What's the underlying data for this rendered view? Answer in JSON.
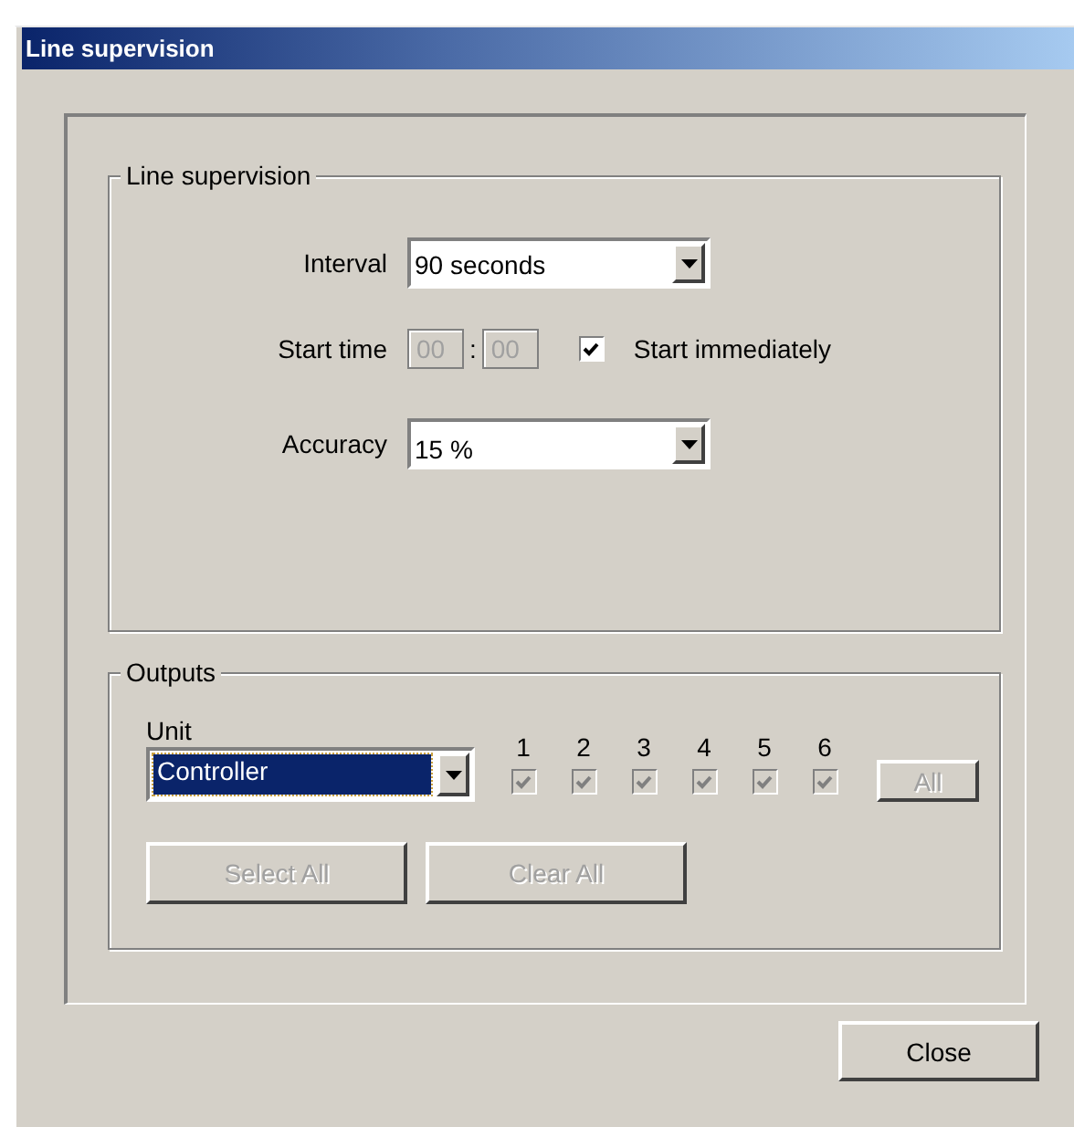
{
  "window": {
    "title": "Line supervision"
  },
  "line_supervision": {
    "title": "Line supervision",
    "interval": {
      "label": "Interval",
      "value": "90 seconds"
    },
    "start_time": {
      "label": "Start time",
      "hours": "00",
      "separator": ":",
      "minutes": "00",
      "disabled": true
    },
    "start_immediately": {
      "label": "Start immediately",
      "checked": true
    },
    "accuracy": {
      "label": "Accuracy",
      "value": "15 %"
    }
  },
  "outputs": {
    "title": "Outputs",
    "unit": {
      "label": "Unit",
      "value": "Controller"
    },
    "channels": [
      {
        "label": "1",
        "checked": true,
        "disabled": true
      },
      {
        "label": "2",
        "checked": true,
        "disabled": true
      },
      {
        "label": "3",
        "checked": true,
        "disabled": true
      },
      {
        "label": "4",
        "checked": true,
        "disabled": true
      },
      {
        "label": "5",
        "checked": true,
        "disabled": true
      },
      {
        "label": "6",
        "checked": true,
        "disabled": true
      }
    ],
    "all_button": {
      "label": "All",
      "disabled": true
    },
    "buttons": [
      {
        "label": "Select All",
        "disabled": true
      },
      {
        "label": "Clear All",
        "disabled": true
      }
    ]
  },
  "buttons": [
    {
      "label": "Close",
      "disabled": false
    }
  ]
}
